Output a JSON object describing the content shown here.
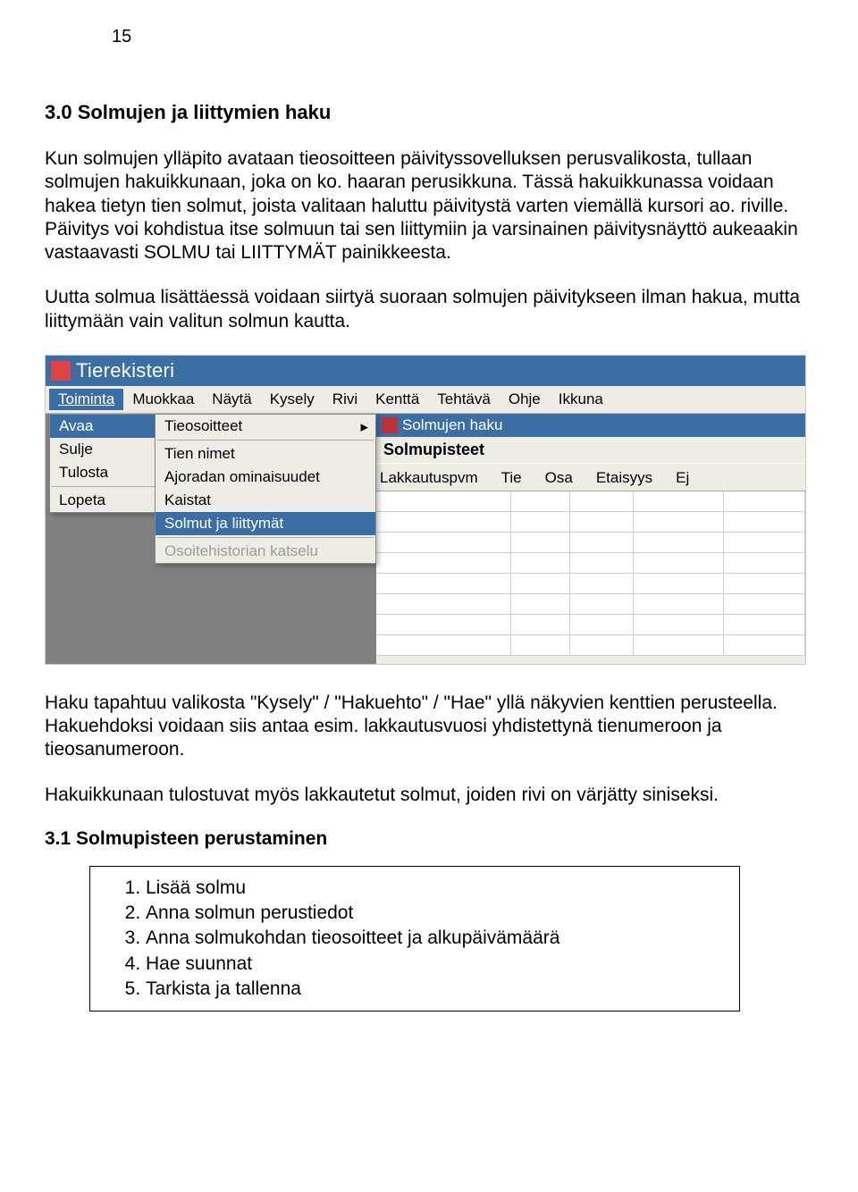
{
  "page_number": "15",
  "heading": "3.0 Solmujen ja liittymien haku",
  "para1": "Kun solmujen ylläpito avataan tieosoitteen päivityssovelluksen perusvalikosta, tullaan solmujen hakuikkunaan, joka on ko. haaran perusikkuna. Tässä hakuikkunassa voidaan hakea tietyn tien solmut, joista valitaan haluttu päivitystä varten viemällä kursori ao. riville. Päivitys voi kohdistua itse solmuun tai sen liittymiin ja varsinainen päivitysnäyttö aukeaakin vastaavasti SOLMU tai LIITTYMÄT painikkeesta.",
  "para2": "Uutta solmua lisättäessä voidaan siirtyä suoraan solmujen päivitykseen ilman hakua, mutta liittymään vain valitun solmun kautta.",
  "screenshot": {
    "app_title": "Tierekisteri",
    "menubar": [
      "Toiminta",
      "Muokkaa",
      "Näytä",
      "Kysely",
      "Rivi",
      "Kenttä",
      "Tehtävä",
      "Ohje",
      "Ikkuna"
    ],
    "dropdown1": {
      "items": [
        "Avaa",
        "Sulje",
        "Tulosta",
        "Lopeta"
      ],
      "open_index": 0
    },
    "dropdown2": {
      "items": [
        {
          "label": "Tieosoitteet",
          "has_arrow": true
        },
        {
          "label": "Tien nimet"
        },
        {
          "label": "Ajoradan ominaisuudet"
        },
        {
          "label": "Kaistat"
        },
        {
          "label": "Solmut ja liittymät",
          "selected": true
        },
        {
          "label": "Osoitehistorian katselu",
          "disabled": true
        }
      ]
    },
    "child_window_title": "Solmujen haku",
    "form_header": "Solmupisteet",
    "grid_headers": [
      "Lakkautuspvm",
      "Tie",
      "Osa",
      "Etaisyys",
      "Ej"
    ]
  },
  "para3": "Haku tapahtuu valikosta \"Kysely\" / \"Hakuehto\" / \"Hae\" yllä näkyvien kenttien perusteella. Hakuehdoksi voidaan siis antaa esim. lakkautusvuosi yhdistettynä tienumeroon ja tieosanumeroon.",
  "para4": "Hakuikkunaan tulostuvat myös lakkautetut solmut, joiden rivi on värjätty siniseksi.",
  "subheading": "3.1 Solmupisteen perustaminen",
  "list": [
    "Lisää solmu",
    "Anna solmun perustiedot",
    "Anna solmukohdan tieosoitteet ja alkupäivämäärä",
    "Hae suunnat",
    "Tarkista ja tallenna"
  ]
}
